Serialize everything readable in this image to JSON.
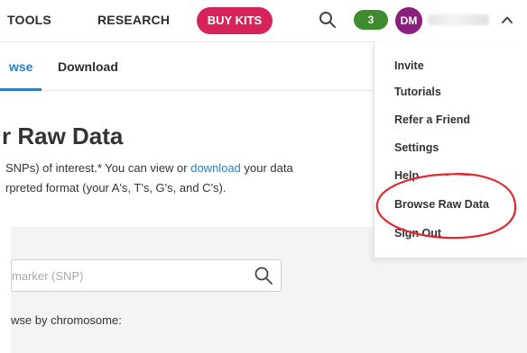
{
  "topnav": {
    "tools_label": "TOOLS",
    "research_label": "RESEARCH",
    "buy_kits_label": "BUY KITS",
    "notification_count": "3",
    "avatar_initials": "DM",
    "icons": {
      "search": "search-icon",
      "chevron": "chevron-up-icon"
    },
    "colors": {
      "buy_kits": "#d6245a",
      "notification": "#3f8b2f",
      "avatar": "#8a1f7d"
    }
  },
  "tabs": [
    {
      "label": "wse",
      "active": true
    },
    {
      "label": "Download",
      "active": false
    }
  ],
  "main": {
    "title": "r Raw Data",
    "desc_line1_pre": "SNPs) of interest.* You can view or ",
    "desc_line1_link": "download",
    "desc_line1_post": " your data",
    "desc_line2": "rpreted format (your A's, T's, G's, and C's).",
    "search_placeholder": "marker (SNP)",
    "browse_by_chromosome": "wse by chromosome:"
  },
  "dropdown": {
    "items": [
      {
        "label": "Invite"
      },
      {
        "label": "Tutorials"
      },
      {
        "label": "Refer a Friend"
      },
      {
        "label": "Settings"
      },
      {
        "label": "Help"
      },
      {
        "label": "Browse Raw Data"
      },
      {
        "label": "Sign Out"
      }
    ],
    "annotation_color": "#e0282e"
  },
  "accent_color": "#2b7fc4"
}
